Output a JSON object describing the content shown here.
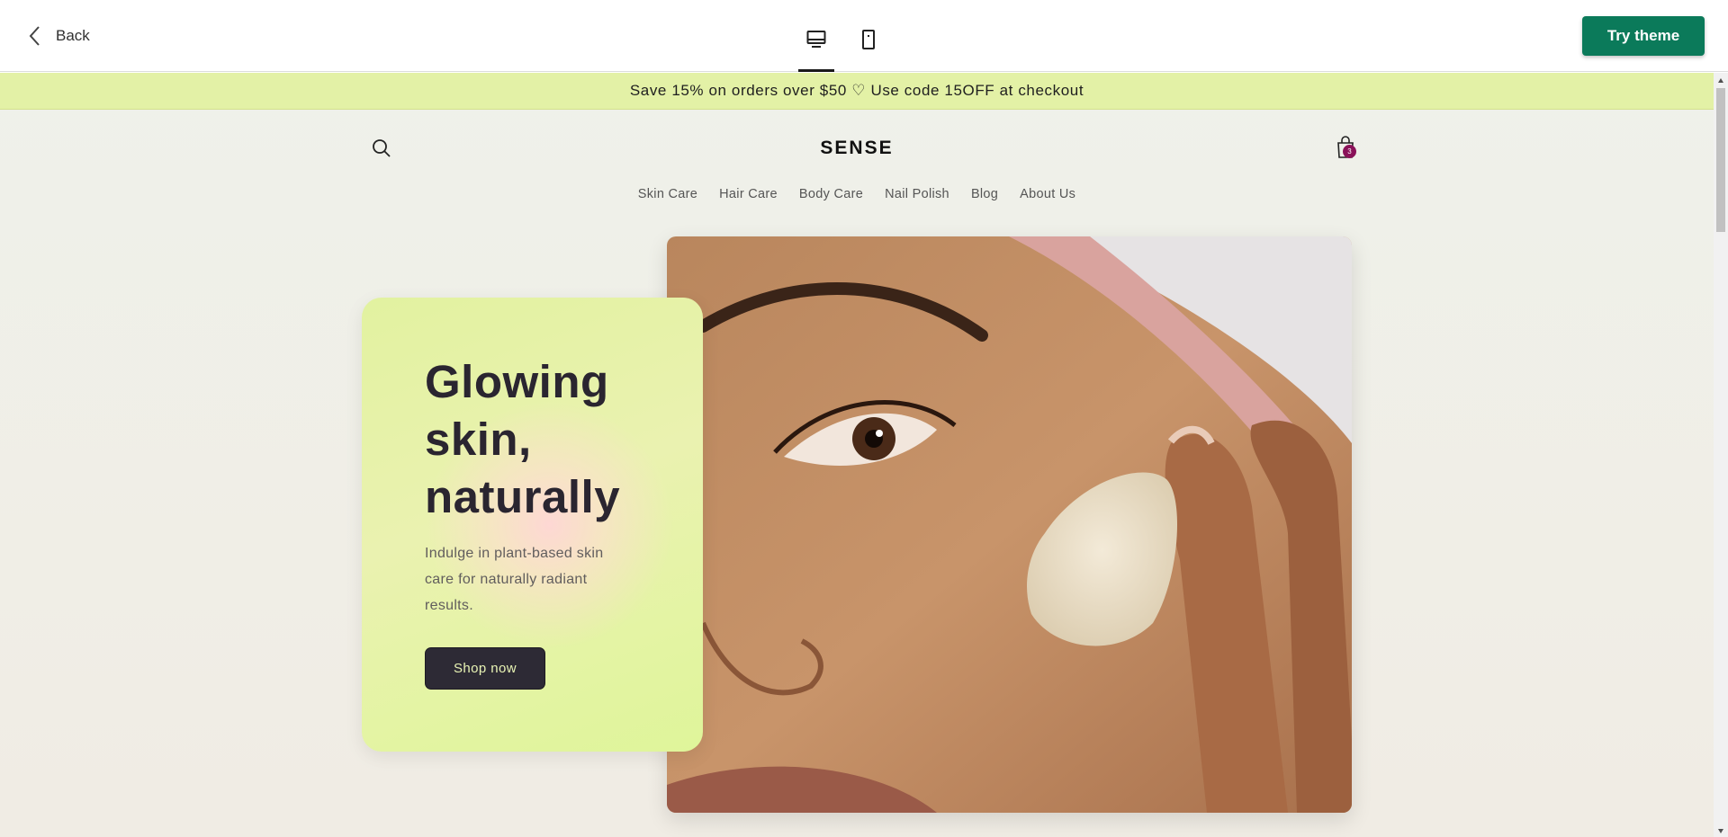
{
  "toolbar": {
    "back_label": "Back",
    "try_theme_label": "Try theme",
    "devices": [
      {
        "icon": "desktop-icon",
        "active": true
      },
      {
        "icon": "mobile-icon",
        "active": false
      }
    ]
  },
  "announcement": {
    "text": "Save 15% on orders over $50 ♡ Use code 15OFF at checkout"
  },
  "store": {
    "logo": "SENSE",
    "cart_count": "3",
    "nav": [
      "Skin Care",
      "Hair Care",
      "Body Care",
      "Nail Polish",
      "Blog",
      "About Us"
    ]
  },
  "hero": {
    "title": "Glowing skin, naturally",
    "text": "Indulge in plant-based skin care for naturally radiant results.",
    "button_label": "Shop now"
  },
  "colors": {
    "brand_button": "#0b7a5a",
    "announcement_bg": "#e3f1a6",
    "cart_badge": "#8a1259",
    "hero_button_bg": "#2d2a35"
  }
}
